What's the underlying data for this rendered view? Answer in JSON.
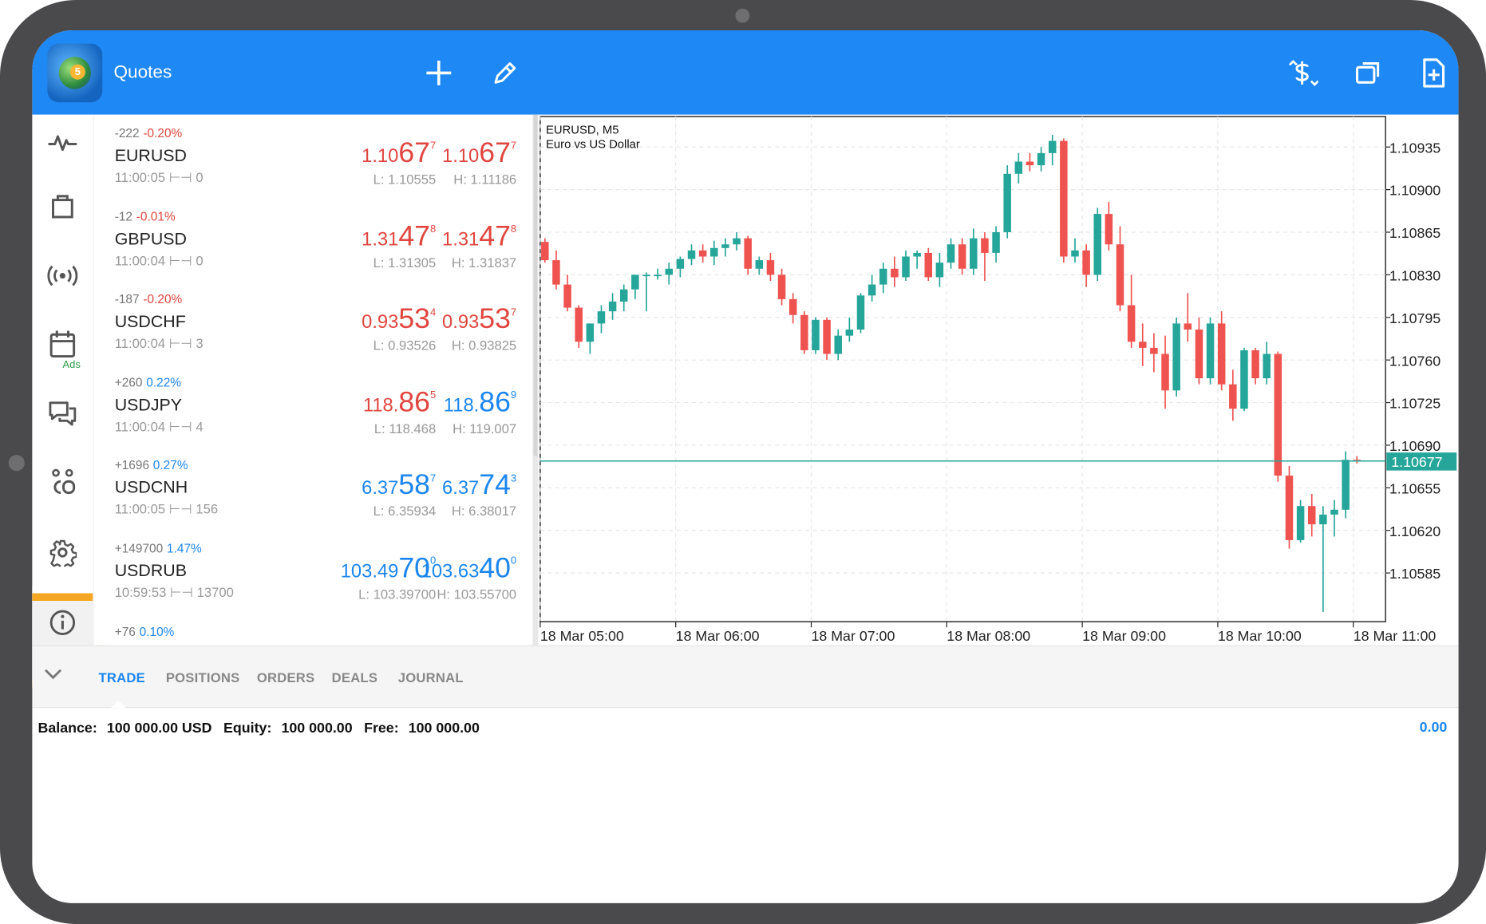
{
  "header": {
    "title": "Quotes"
  },
  "rail": {
    "ads_label": "Ads"
  },
  "quotes": [
    {
      "change": "-222",
      "pct": "-0.20%",
      "pct_color": "#e0463f",
      "symbol": "EURUSD",
      "time": "11:00:05",
      "spread": "0",
      "bid": {
        "pre": "1.10",
        "big": "67",
        "sup": "7",
        "color": "#e0463f"
      },
      "ask": {
        "pre": "1.10",
        "big": "67",
        "sup": "7",
        "color": "#e0463f"
      },
      "low": "L: 1.10555",
      "high": "H: 1.11186"
    },
    {
      "change": "-12",
      "pct": "-0.01%",
      "pct_color": "#e0463f",
      "symbol": "GBPUSD",
      "time": "11:00:04",
      "spread": "0",
      "bid": {
        "pre": "1.31",
        "big": "47",
        "sup": "8",
        "color": "#e0463f"
      },
      "ask": {
        "pre": "1.31",
        "big": "47",
        "sup": "8",
        "color": "#e0463f"
      },
      "low": "L: 1.31305",
      "high": "H: 1.31837"
    },
    {
      "change": "-187",
      "pct": "-0.20%",
      "pct_color": "#e0463f",
      "symbol": "USDCHF",
      "time": "11:00:04",
      "spread": "3",
      "bid": {
        "pre": "0.93",
        "big": "53",
        "sup": "4",
        "color": "#e0463f"
      },
      "ask": {
        "pre": "0.93",
        "big": "53",
        "sup": "7",
        "color": "#e0463f"
      },
      "low": "L: 0.93526",
      "high": "H: 0.93825"
    },
    {
      "change": "+260",
      "pct": "0.22%",
      "pct_color": "#1c86ee",
      "symbol": "USDJPY",
      "time": "11:00:04",
      "spread": "4",
      "bid": {
        "pre": "118.",
        "big": "86",
        "sup": "5",
        "color": "#e0463f"
      },
      "ask": {
        "pre": "118.",
        "big": "86",
        "sup": "9",
        "color": "#1c86ee"
      },
      "low": "L: 118.468",
      "high": "H: 119.007"
    },
    {
      "change": "+1696",
      "pct": "0.27%",
      "pct_color": "#1c86ee",
      "symbol": "USDCNH",
      "time": "11:00:05",
      "spread": "156",
      "bid": {
        "pre": "6.37",
        "big": "58",
        "sup": "7",
        "color": "#1c86ee"
      },
      "ask": {
        "pre": "6.37",
        "big": "74",
        "sup": "3",
        "color": "#1c86ee"
      },
      "low": "L: 6.35934",
      "high": "H: 6.38017"
    },
    {
      "change": "+149700",
      "pct": "1.47%",
      "pct_color": "#1c86ee",
      "symbol": "USDRUB",
      "time": "10:59:53",
      "spread": "13700",
      "bid": {
        "pre": "103.49",
        "big": "70",
        "sup": "0",
        "color": "#1c86ee"
      },
      "ask": {
        "pre": "103.63",
        "big": "40",
        "sup": "0",
        "color": "#1c86ee"
      },
      "low": "L: 103.39700",
      "high": "H: 103.55700"
    },
    {
      "change": "+76",
      "pct": "0.10%",
      "pct_color": "#1c86ee",
      "symbol": "",
      "time": "",
      "spread": "",
      "bid": {
        "pre": "",
        "big": "",
        "sup": "",
        "color": "#1c86ee"
      },
      "ask": {
        "pre": "",
        "big": "",
        "sup": "",
        "color": "#1c86ee"
      },
      "low": "",
      "high": ""
    }
  ],
  "tabs": [
    {
      "label": "TRADE",
      "active": true
    },
    {
      "label": "POSITIONS",
      "active": false
    },
    {
      "label": "ORDERS",
      "active": false
    },
    {
      "label": "DEALS",
      "active": false
    },
    {
      "label": "JOURNAL",
      "active": false
    }
  ],
  "account": {
    "balance_label": "Balance:",
    "balance_value": "100 000.00 USD",
    "equity_label": "Equity:",
    "equity_value": "100 000.00",
    "free_label": "Free:",
    "free_value": "100 000.00",
    "profit": "0.00"
  },
  "chart_data": {
    "type": "candlestick",
    "title": "EURUSD, M5",
    "subtitle": "Euro vs US Dollar",
    "ylim": [
      1.10545,
      1.1096
    ],
    "y_ticks": [
      "1.10935",
      "1.10900",
      "1.10865",
      "1.10830",
      "1.10795",
      "1.10760",
      "1.10725",
      "1.10690",
      "1.10655",
      "1.10620",
      "1.10585"
    ],
    "x_ticks": [
      "18 Mar 05:00",
      "18 Mar 06:00",
      "18 Mar 07:00",
      "18 Mar 08:00",
      "18 Mar 09:00",
      "18 Mar 10:00",
      "18 Mar 11:00"
    ],
    "current_price": "1.10677",
    "up_color": "#26a69a",
    "down_color": "#ef5350",
    "price_line_color": "#26a69a",
    "candles": [
      [
        1.10857,
        1.1086,
        1.1084,
        1.10842
      ],
      [
        1.10842,
        1.1085,
        1.10818,
        1.10822
      ],
      [
        1.10822,
        1.1083,
        1.108,
        1.10803
      ],
      [
        1.10803,
        1.10805,
        1.1077,
        1.10775
      ],
      [
        1.10775,
        1.1079,
        1.10765,
        1.1079
      ],
      [
        1.1079,
        1.10805,
        1.10782,
        1.108
      ],
      [
        1.108,
        1.10815,
        1.10793,
        1.10808
      ],
      [
        1.10808,
        1.10822,
        1.108,
        1.10818
      ],
      [
        1.10818,
        1.1083,
        1.1081,
        1.1083
      ],
      [
        1.1083,
        1.10832,
        1.108,
        1.1083
      ],
      [
        1.1083,
        1.10835,
        1.10826,
        1.1083
      ],
      [
        1.1083,
        1.1084,
        1.10822,
        1.10835
      ],
      [
        1.10835,
        1.10845,
        1.10828,
        1.10843
      ],
      [
        1.10843,
        1.10855,
        1.10838,
        1.1085
      ],
      [
        1.1085,
        1.10855,
        1.1084,
        1.10845
      ],
      [
        1.10845,
        1.10858,
        1.10838,
        1.10852
      ],
      [
        1.10852,
        1.1086,
        1.10845,
        1.10855
      ],
      [
        1.10855,
        1.10865,
        1.1085,
        1.1086
      ],
      [
        1.1086,
        1.10862,
        1.1083,
        1.10835
      ],
      [
        1.10835,
        1.10845,
        1.1083,
        1.10842
      ],
      [
        1.10842,
        1.10848,
        1.10825,
        1.1083
      ],
      [
        1.1083,
        1.10835,
        1.10805,
        1.1081
      ],
      [
        1.1081,
        1.10815,
        1.1079,
        1.10797
      ],
      [
        1.10797,
        1.108,
        1.10765,
        1.10768
      ],
      [
        1.10768,
        1.10795,
        1.10765,
        1.10793
      ],
      [
        1.10793,
        1.10795,
        1.1076,
        1.10765
      ],
      [
        1.10765,
        1.10785,
        1.1076,
        1.1078
      ],
      [
        1.1078,
        1.10795,
        1.10775,
        1.10785
      ],
      [
        1.10785,
        1.10815,
        1.10782,
        1.10813
      ],
      [
        1.10813,
        1.1083,
        1.10808,
        1.10822
      ],
      [
        1.10822,
        1.1084,
        1.10815,
        1.10835
      ],
      [
        1.10835,
        1.10845,
        1.1082,
        1.10828
      ],
      [
        1.10828,
        1.1085,
        1.10825,
        1.10845
      ],
      [
        1.10845,
        1.1085,
        1.10835,
        1.10848
      ],
      [
        1.10848,
        1.10852,
        1.10825,
        1.10828
      ],
      [
        1.10828,
        1.10848,
        1.1082,
        1.1084
      ],
      [
        1.1084,
        1.1086,
        1.10835,
        1.10855
      ],
      [
        1.10855,
        1.1086,
        1.1083,
        1.10835
      ],
      [
        1.10835,
        1.10868,
        1.1083,
        1.1086
      ],
      [
        1.1086,
        1.10865,
        1.10825,
        1.10848
      ],
      [
        1.10848,
        1.1087,
        1.1084,
        1.10865
      ],
      [
        1.10865,
        1.1092,
        1.1086,
        1.10913
      ],
      [
        1.10913,
        1.1093,
        1.10905,
        1.10923
      ],
      [
        1.10923,
        1.1093,
        1.10915,
        1.1092
      ],
      [
        1.1092,
        1.10935,
        1.10915,
        1.1093
      ],
      [
        1.1093,
        1.10945,
        1.1092,
        1.1094
      ],
      [
        1.1094,
        1.10942,
        1.1084,
        1.10845
      ],
      [
        1.10845,
        1.1086,
        1.1084,
        1.1085
      ],
      [
        1.1085,
        1.10855,
        1.1082,
        1.1083
      ],
      [
        1.1083,
        1.10885,
        1.10825,
        1.1088
      ],
      [
        1.1088,
        1.1089,
        1.1085,
        1.10855
      ],
      [
        1.10855,
        1.1087,
        1.108,
        1.10805
      ],
      [
        1.10805,
        1.1083,
        1.1077,
        1.10775
      ],
      [
        1.10775,
        1.1079,
        1.10755,
        1.1077
      ],
      [
        1.1077,
        1.10782,
        1.1075,
        1.10765
      ],
      [
        1.10765,
        1.1078,
        1.1072,
        1.10735
      ],
      [
        1.10735,
        1.10795,
        1.1073,
        1.1079
      ],
      [
        1.1079,
        1.10815,
        1.10775,
        1.10785
      ],
      [
        1.10785,
        1.10795,
        1.1074,
        1.10745
      ],
      [
        1.10745,
        1.10795,
        1.1074,
        1.1079
      ],
      [
        1.1079,
        1.108,
        1.10735,
        1.1074
      ],
      [
        1.1074,
        1.10752,
        1.1071,
        1.1072
      ],
      [
        1.1072,
        1.1077,
        1.10718,
        1.10768
      ],
      [
        1.10768,
        1.1077,
        1.1074,
        1.10745
      ],
      [
        1.10745,
        1.10775,
        1.1074,
        1.10765
      ],
      [
        1.10765,
        1.10767,
        1.1066,
        1.10665
      ],
      [
        1.10665,
        1.10673,
        1.10605,
        1.10612
      ],
      [
        1.10612,
        1.10645,
        1.1061,
        1.1064
      ],
      [
        1.1064,
        1.1065,
        1.10615,
        1.10625
      ],
      [
        1.10625,
        1.1064,
        1.10553,
        1.10633
      ],
      [
        1.10633,
        1.10645,
        1.10615,
        1.10637
      ],
      [
        1.10637,
        1.10685,
        1.1063,
        1.10678
      ],
      [
        1.10678,
        1.10681,
        1.10675,
        1.10677
      ]
    ]
  }
}
